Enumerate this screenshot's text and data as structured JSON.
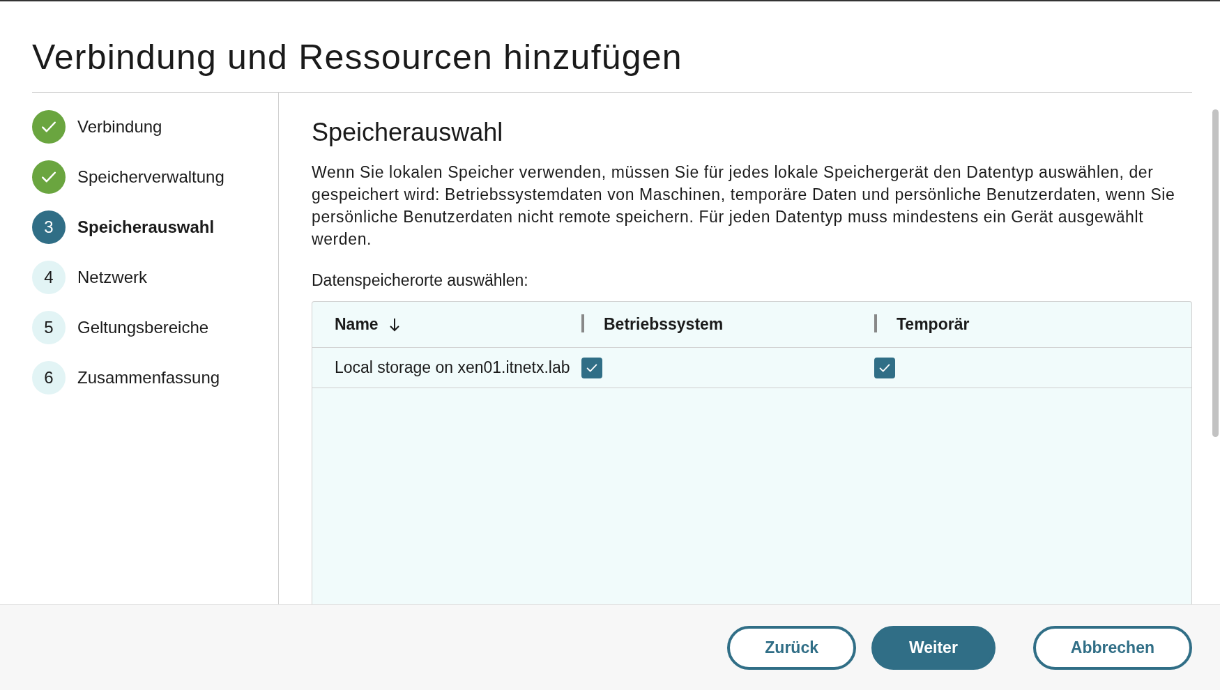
{
  "title": "Verbindung und Ressourcen hinzufügen",
  "steps": [
    {
      "label": "Verbindung",
      "kind": "done",
      "selected": false
    },
    {
      "label": "Speicherverwaltung",
      "kind": "done",
      "selected": false
    },
    {
      "number": "3",
      "label": "Speicherauswahl",
      "kind": "current",
      "selected": true
    },
    {
      "number": "4",
      "label": "Netzwerk",
      "kind": "pending",
      "selected": false
    },
    {
      "number": "5",
      "label": "Geltungsbereiche",
      "kind": "pending",
      "selected": false
    },
    {
      "number": "6",
      "label": "Zusammenfassung",
      "kind": "pending",
      "selected": false
    }
  ],
  "section": {
    "heading": "Speicherauswahl",
    "description": "Wenn Sie lokalen Speicher verwenden, müssen Sie für jedes lokale Speichergerät den Datentyp auswählen, der gespeichert wird: Betriebssystemdaten von Maschinen, temporäre Daten und persönliche Benutzerdaten, wenn Sie persönliche Benutzerdaten nicht remote speichern. Für jeden Datentyp muss mindestens ein Gerät ausgewählt werden.",
    "table_label": "Datenspeicherorte auswählen:"
  },
  "table": {
    "columns": [
      {
        "label": "Name",
        "sorted": true
      },
      {
        "label": "Betriebssystem",
        "sorted": false
      },
      {
        "label": "Temporär",
        "sorted": false
      }
    ],
    "rows": [
      {
        "name": "Local storage on xen01.itnetx.lab",
        "os_checked": true,
        "temp_checked": true
      }
    ]
  },
  "buttons": [
    {
      "label": "Zurück",
      "kind": "secondary"
    },
    {
      "label": "Weiter",
      "kind": "primary"
    },
    {
      "label": "Abbrechen",
      "kind": "secondary"
    }
  ]
}
